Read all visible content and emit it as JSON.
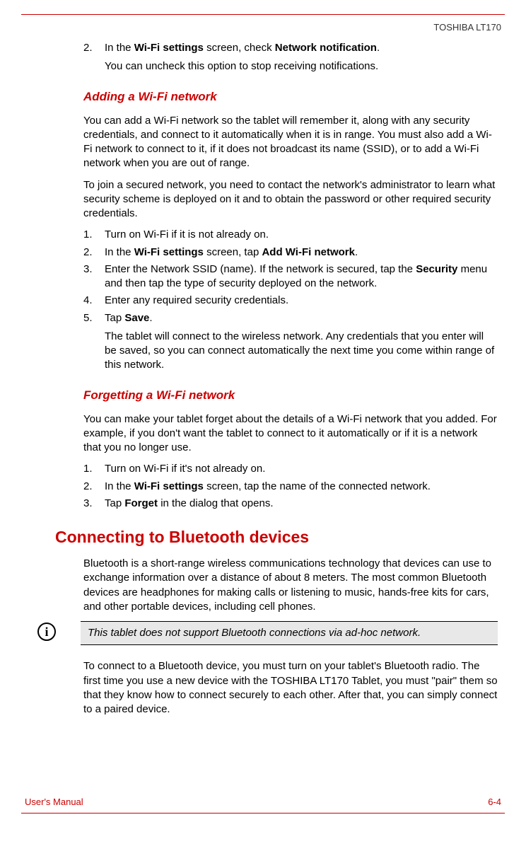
{
  "header": {
    "product": "TOSHIBA LT170"
  },
  "section1": {
    "step2_num": "2.",
    "step2_text_a": "In the ",
    "step2_bold_a": "Wi-Fi settings",
    "step2_text_b": " screen, check ",
    "step2_bold_b": "Network notification",
    "step2_text_c": ".",
    "step2_sub": "You can uncheck this option to stop receiving notifications."
  },
  "adding": {
    "heading": "Adding a Wi-Fi network",
    "para1": "You can add a Wi-Fi network so the tablet will remember it, along with any security credentials, and connect to it automatically when it is in range. You must also add a Wi-Fi network to connect to it, if it does not broadcast its name (SSID), or to add a Wi-Fi network when you are out of range.",
    "para2": "To join a secured network, you need to contact the network's administrator to learn what security scheme is deployed on it and to obtain the password or other required security credentials.",
    "s1_num": "1.",
    "s1_txt": "Turn on Wi-Fi if it is not already on.",
    "s2_num": "2.",
    "s2_a": "In the ",
    "s2_b1": "Wi-Fi settings",
    "s2_b": " screen, tap ",
    "s2_b2": "Add Wi-Fi network",
    "s2_c": ".",
    "s3_num": "3.",
    "s3_a": "Enter the Network SSID (name). If the network is secured, tap the ",
    "s3_b1": "Security",
    "s3_b": " menu and then tap the type of security deployed on the network.",
    "s4_num": "4.",
    "s4_txt": "Enter any required security credentials.",
    "s5_num": "5.",
    "s5_a": "Tap ",
    "s5_b1": "Save",
    "s5_b": ".",
    "s5_sub": "The tablet will connect to the wireless network. Any credentials that you enter will be saved, so you can connect automatically the next time you come within range of this network."
  },
  "forgetting": {
    "heading": "Forgetting a Wi-Fi network",
    "para1": "You can make your tablet forget about the details of a Wi-Fi network that you added. For example, if you don't want the tablet to connect to it automatically or if it is a network that you no longer use.",
    "s1_num": "1.",
    "s1_txt": "Turn on Wi-Fi if it's not already on.",
    "s2_num": "2.",
    "s2_a": "In the ",
    "s2_b1": "Wi-Fi settings",
    "s2_b": " screen, tap the name of the connected network.",
    "s3_num": "3.",
    "s3_a": "Tap ",
    "s3_b1": "Forget",
    "s3_b": " in the dialog that opens."
  },
  "bluetooth": {
    "heading": "Connecting to Bluetooth devices",
    "para1": "Bluetooth is a short-range wireless communications technology that devices can use to exchange information over a distance of about 8 meters. The most common Bluetooth devices are headphones for making calls or listening to music, hands-free kits for cars, and other portable devices, including cell phones.",
    "note": "This tablet does not support Bluetooth connections via ad-hoc network.",
    "para2": "To connect to a Bluetooth device, you must turn on your tablet's Bluetooth radio. The first time you use a new device with the TOSHIBA LT170 Tablet, you must \"pair\" them so that they know how to connect securely to each other. After that, you can simply connect to a paired device."
  },
  "footer": {
    "left": "User's Manual",
    "right": "6-4"
  },
  "icon": {
    "info": "i"
  }
}
